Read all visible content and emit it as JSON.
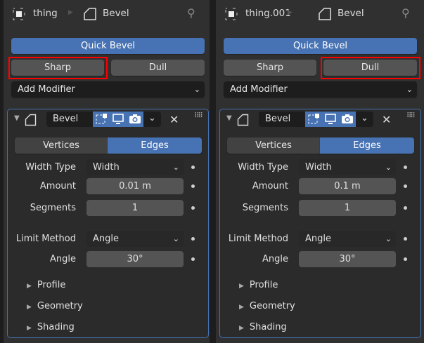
{
  "panels": [
    {
      "object_name": "thing",
      "modifier_breadcrumb": "Bevel",
      "quick_bevel": "Quick Bevel",
      "sharp": "Sharp",
      "dull": "Dull",
      "highlighted": "sharp",
      "add_modifier": "Add Modifier",
      "modifier": {
        "name": "Bevel",
        "tabs": [
          "Vertices",
          "Edges"
        ],
        "active_tab": "Edges",
        "fields": [
          {
            "label": "Width Type",
            "value": "Width",
            "type": "select"
          },
          {
            "label": "Amount",
            "value": "0.01 m",
            "type": "number"
          },
          {
            "label": "Segments",
            "value": "1",
            "type": "number"
          },
          {
            "label": "Limit Method",
            "value": "Angle",
            "type": "select"
          },
          {
            "label": "Angle",
            "value": "30°",
            "type": "number"
          }
        ],
        "subpanels": [
          "Profile",
          "Geometry",
          "Shading"
        ]
      }
    },
    {
      "object_name": "thing.001",
      "modifier_breadcrumb": "Bevel",
      "quick_bevel": "Quick Bevel",
      "sharp": "Sharp",
      "dull": "Dull",
      "highlighted": "dull",
      "add_modifier": "Add Modifier",
      "modifier": {
        "name": "Bevel",
        "tabs": [
          "Vertices",
          "Edges"
        ],
        "active_tab": "Edges",
        "fields": [
          {
            "label": "Width Type",
            "value": "Width",
            "type": "select"
          },
          {
            "label": "Amount",
            "value": "0.1 m",
            "type": "number"
          },
          {
            "label": "Segments",
            "value": "1",
            "type": "number"
          },
          {
            "label": "Limit Method",
            "value": "Angle",
            "type": "select"
          },
          {
            "label": "Angle",
            "value": "30°",
            "type": "number"
          }
        ],
        "subpanels": [
          "Profile",
          "Geometry",
          "Shading"
        ]
      }
    }
  ],
  "colors": {
    "accent": "#4772b3",
    "highlight": "#ff0000"
  }
}
